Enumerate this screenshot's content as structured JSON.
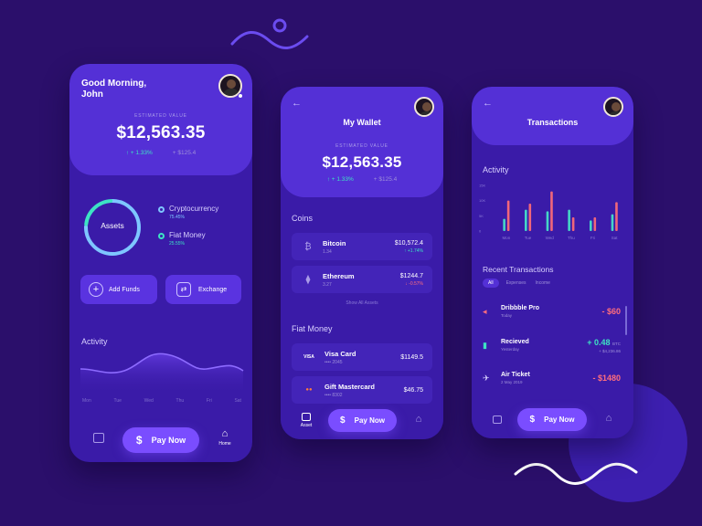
{
  "colors": {
    "background": "#2b0f6b",
    "card": "#3a1ba8",
    "header": "#5430d6",
    "accent": "#7a4dff",
    "positive": "#3de3c4",
    "negative": "#ff6e7d",
    "bar_teal": "#45d6c7",
    "bar_red": "#f0667a"
  },
  "screen1": {
    "greeting": "Good Morning,",
    "name": "John",
    "estimated_label": "ESTIMATED VALUE",
    "balance": "$12,563.35",
    "delta_pct": "↑ + 1.33%",
    "delta_abs": "+ $125.4",
    "ring_label": "Assets",
    "legend": [
      {
        "label": "Cryptocurrency",
        "pct": "75.45%",
        "color": "#7ec6ff"
      },
      {
        "label": "Fiat Money",
        "pct": "25.55%",
        "color": "#3de3c4"
      }
    ],
    "add_funds": "Add Funds",
    "exchange": "Exchange",
    "activity_title": "Activity",
    "days": [
      "Mon",
      "Tue",
      "Wed",
      "Thu",
      "Fri",
      "Sat"
    ],
    "pay_now": "Pay Now",
    "home_label": "Home"
  },
  "screen2": {
    "title": "My Wallet",
    "estimated_label": "ESTIMATED VALUE",
    "balance": "$12,563.35",
    "delta_pct": "↑ + 1.33%",
    "delta_abs": "+ $125.4",
    "coins_title": "Coins",
    "coins": [
      {
        "name": "Bitcoin",
        "amount": "1.34",
        "value": "$10,572.4",
        "change": "↑ +1.74%",
        "icon": "₿",
        "dir": "up"
      },
      {
        "name": "Ethereum",
        "amount": "3.27",
        "value": "$1244.7",
        "change": "↓ -0.57%",
        "icon": "⧫",
        "dir": "down"
      }
    ],
    "show_all": "Show All Assets",
    "fiat_title": "Fiat Money",
    "fiat": [
      {
        "name": "Visa Card",
        "sub": "•••• 2045",
        "value": "$1149.5",
        "icon": "VISA"
      },
      {
        "name": "Gift Mastercard",
        "sub": "•••• 8302",
        "value": "$46.75",
        "icon": "●●"
      }
    ],
    "nav_asset": "Asset",
    "pay_now": "Pay Now"
  },
  "screen3": {
    "title": "Transactions",
    "activity_title": "Activity",
    "y_ticks": [
      "15K",
      "10K",
      "5K",
      "0"
    ],
    "recent_title": "Recent Transactions",
    "filters": [
      "All",
      "Expenses",
      "Income"
    ],
    "transactions": [
      {
        "name": "Dribbble Pro",
        "date": "Today",
        "value": "- $60",
        "unit": "",
        "sub": "",
        "icon": "◂",
        "dir": "down"
      },
      {
        "name": "Recieved",
        "date": "Yesterday",
        "value": "+ 0.48",
        "unit": "BTC",
        "sub": "+ $4,236.86",
        "icon": "▮",
        "dir": "up"
      },
      {
        "name": "Air Ticket",
        "date": "2 May 2019",
        "value": "- $1480",
        "unit": "",
        "sub": "",
        "icon": "✈",
        "dir": "down"
      }
    ],
    "pay_now": "Pay Now"
  },
  "chart_data": {
    "type": "bar",
    "categories": [
      "Mon",
      "Tue",
      "Wed",
      "Thu",
      "Fri",
      "Sat"
    ],
    "series": [
      {
        "values": [
          4000,
          7000,
          6500,
          7000,
          3500,
          5500
        ]
      },
      {
        "values": [
          10000,
          9000,
          13000,
          4500,
          4500,
          9500
        ]
      }
    ],
    "ylim": [
      0,
      15000
    ],
    "y_ticks": [
      "15K",
      "10K",
      "5K",
      "0"
    ],
    "title": "Activity"
  }
}
